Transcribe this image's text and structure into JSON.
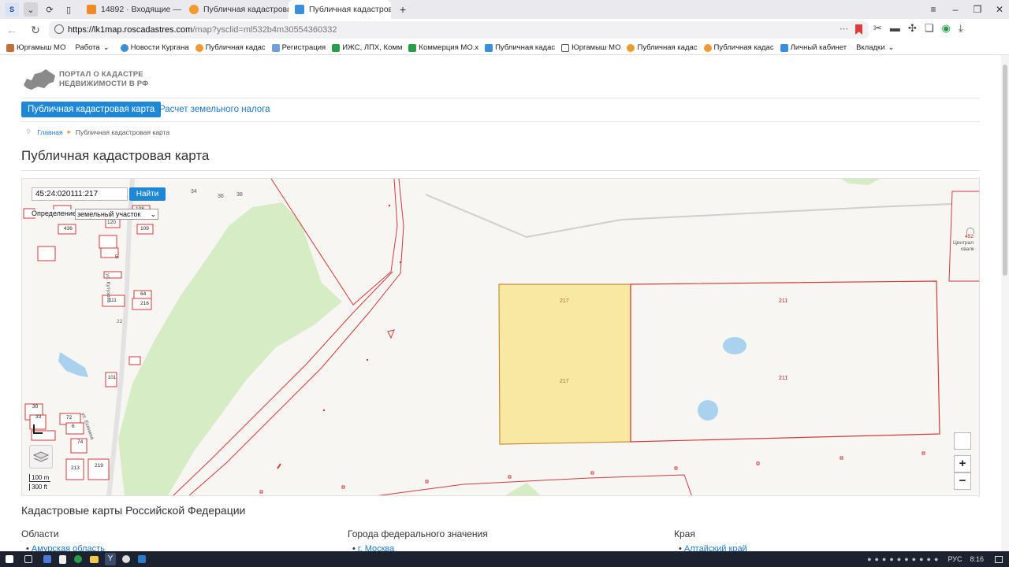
{
  "browser": {
    "tab_strip_first": "S",
    "tabs": [
      {
        "label": "14892 · Входящие — Янд"
      },
      {
        "label": "Публичная кадастровая"
      },
      {
        "label": "Публичная кадастрова"
      }
    ],
    "url_host": "https://lk1map.roscadastres.com",
    "url_path": "/map?ysclid=ml532b4m30554360332",
    "bookmarks": [
      "Юргамыш МО",
      "Работа",
      "Новости Кургана",
      "Публичная кадас",
      "Регистрация",
      "ИЖС, ЛПХ, Комм",
      "Коммерция МО.х",
      "Публичная кадас",
      "Юргамыш МО",
      "Публичная кадас",
      "Публичная кадас",
      "Личный кабинет",
      "Вкладки"
    ]
  },
  "site": {
    "logo_line1": "ПОРТАЛ О КАДАСТРЕ",
    "logo_line2": "НЕДВИЖИМОСТИ В РФ",
    "nav_main": "Публичная кадастровая карта",
    "nav_tax": "Расчет земельного налога",
    "crumb_home": "Главная",
    "crumb_current": "Публичная кадастровая карта",
    "page_title": "Публичная кадастровая карта"
  },
  "map": {
    "search_value": "45:24:020111:217",
    "find_label": "Найти",
    "definition_label": "Определение:",
    "definition_value": "земельный участок",
    "parcel_labels": [
      "217",
      "217",
      "211",
      "211"
    ],
    "small_labels": [
      "34",
      "36",
      "38",
      "108",
      "436",
      "120",
      "109",
      "5",
      "64",
      "111",
      "216",
      "22",
      "101",
      "30",
      "33",
      "72",
      "6",
      "74",
      "219",
      "213",
      "452"
    ],
    "street_labels": [
      "ул. Кутузова",
      "ул. Есенина"
    ],
    "poi_label_1": "Централ",
    "poi_label_2": "свалк",
    "scale_m": "100 m",
    "scale_ft": "300 ft",
    "zoom_in": "+",
    "zoom_out": "−",
    "colors": {
      "selected_fill": "#f7e9a2",
      "parcel_line": "#d23a3a",
      "forest": "#d6ecc4",
      "water": "#a9d2ef"
    }
  },
  "footer": {
    "section_title": "Кадастровые карты Российской Федерации",
    "col1_title": "Области",
    "col1_first": "Амурская область",
    "col2_title": "Города федерального значения",
    "col2_first": "г. Москва",
    "col3_title": "Края",
    "col3_first": "Алтайский край"
  },
  "taskbar": {
    "lang": "РУС",
    "time": "8:16"
  }
}
